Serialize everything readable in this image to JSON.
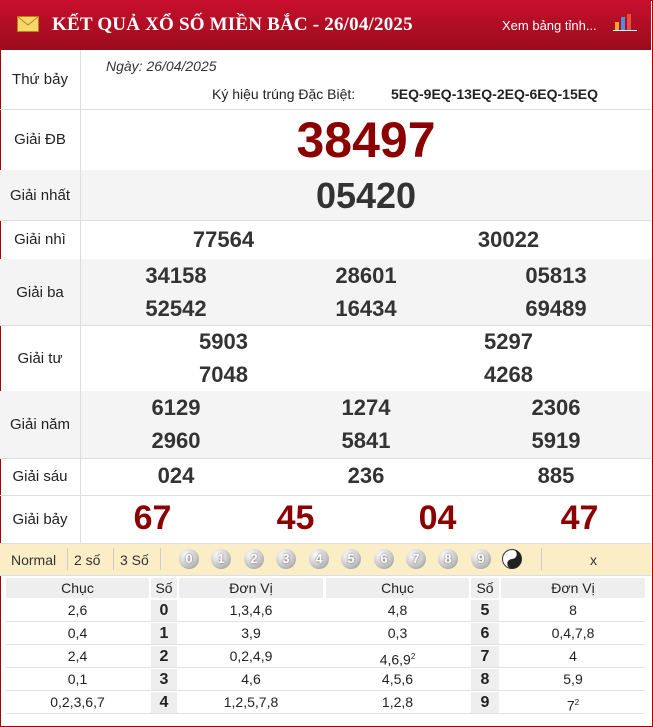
{
  "header": {
    "title": "KẾT QUẢ XỔ SỐ MIỀN BẮC - 26/04/2025",
    "view_link": "Xem bảng tỉnh...",
    "envelope_icon": "envelope-icon",
    "chart_icon": "bar-chart-icon"
  },
  "info": {
    "weekday": "Thứ bảy",
    "date": "Ngày: 26/04/2025",
    "special_code_label": "Ký hiệu trúng Đặc Biệt:",
    "special_code_value": "5EQ-9EQ-13EQ-2EQ-6EQ-15EQ"
  },
  "prizes": {
    "db": {
      "label": "Giải ĐB",
      "numbers": [
        "38497"
      ]
    },
    "nhat": {
      "label": "Giải nhất",
      "numbers": [
        "05420"
      ]
    },
    "nhi": {
      "label": "Giải nhì",
      "numbers": [
        "77564",
        "30022"
      ]
    },
    "ba": {
      "label": "Giải ba",
      "numbers": [
        "34158",
        "28601",
        "05813",
        "52542",
        "16434",
        "69489"
      ]
    },
    "tu": {
      "label": "Giải tư",
      "numbers": [
        "5903",
        "5297",
        "7048",
        "4268"
      ]
    },
    "nam": {
      "label": "Giải năm",
      "numbers": [
        "6129",
        "1274",
        "2306",
        "2960",
        "5841",
        "5919"
      ]
    },
    "sau": {
      "label": "Giải sáu",
      "numbers": [
        "024",
        "236",
        "885"
      ]
    },
    "bay": {
      "label": "Giải bảy",
      "numbers": [
        "67",
        "45",
        "04",
        "47"
      ]
    }
  },
  "check_bar": {
    "options": [
      "Normal",
      "2 số",
      "3 Số"
    ],
    "digits": [
      "0",
      "1",
      "2",
      "3",
      "4",
      "5",
      "6",
      "7",
      "8",
      "9"
    ],
    "close": "x"
  },
  "loto": {
    "headers": {
      "chuc": "Chục",
      "so": "Số",
      "donvi": "Đơn Vị"
    },
    "left": [
      {
        "chuc": "2,6",
        "so": "0",
        "donvi": "1,3,4,6"
      },
      {
        "chuc": "0,4",
        "so": "1",
        "donvi": "3,9"
      },
      {
        "chuc": "2,4",
        "so": "2",
        "donvi": "0,2,4,9"
      },
      {
        "chuc": "0,1",
        "so": "3",
        "donvi": "4,6"
      },
      {
        "chuc": "0,2,3,6,7",
        "so": "4",
        "donvi": "1,2,5,7,8"
      }
    ],
    "right": [
      {
        "chuc": "4,8",
        "so": "5",
        "donvi": "8"
      },
      {
        "chuc": "0,3",
        "so": "6",
        "donvi": "0,4,7,8"
      },
      {
        "chuc": "4,6,9",
        "chuc_sup": "2",
        "so": "7",
        "donvi": "4"
      },
      {
        "chuc": "4,5,6",
        "so": "8",
        "donvi": "5,9"
      },
      {
        "chuc": "1,2,8",
        "so": "9",
        "donvi": "7",
        "donvi_sup": "2"
      }
    ]
  }
}
